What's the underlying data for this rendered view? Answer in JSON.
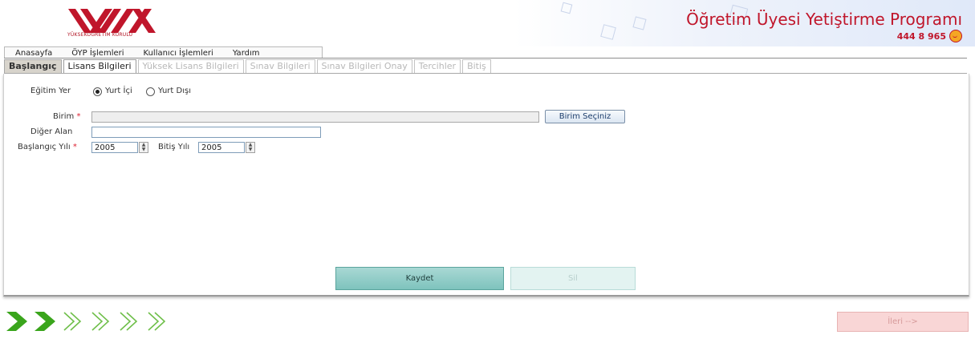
{
  "header": {
    "logo_text": "YÜKSEKÖĞRETİM KURULU",
    "app_title": "Öğretim Üyesi Yetiştirme Programı",
    "phone": "444 8 965"
  },
  "menu": {
    "items": [
      "Anasayfa",
      "ÖYP İşlemleri",
      "Kullanıcı İşlemleri",
      "Yardım"
    ]
  },
  "tabs": [
    {
      "label": "Başlangıç",
      "state": "visited"
    },
    {
      "label": "Lisans Bilgileri",
      "state": "active"
    },
    {
      "label": "Yüksek Lisans Bilgileri",
      "state": "disabled"
    },
    {
      "label": "Sınav Bilgileri",
      "state": "disabled"
    },
    {
      "label": "Sınav Bilgileri Onay",
      "state": "disabled"
    },
    {
      "label": "Tercihler",
      "state": "disabled"
    },
    {
      "label": "Bitiş",
      "state": "disabled"
    }
  ],
  "form": {
    "egitim_yer_label": "Eğitim Yer",
    "radio_yurt_ici": "Yurt İçi",
    "radio_yurt_disi": "Yurt Dışı",
    "selected_radio": "Yurt İçi",
    "birim_label": "Birim",
    "required_mark": "*",
    "birim_value": "",
    "birim_button": "Birim Seçiniz",
    "diger_alan_label": "Diğer Alan",
    "diger_alan_value": "",
    "baslangic_yili_label": "Başlangıç Yılı",
    "baslangic_yili_value": "2005",
    "bitis_yili_label": "Bitiş Yılı",
    "bitis_yili_value": "2005"
  },
  "actions": {
    "save_label": "Kaydet",
    "delete_label": "Sil",
    "next_label": "İleri -->"
  },
  "steps": {
    "total": 6,
    "completed": 2,
    "active_color": "#3aa51c",
    "inactive_color": "#6fbf4a"
  },
  "colors": {
    "brand": "#c0162b",
    "save_button": "#8cc9c3",
    "next_button": "#f9d6d6"
  }
}
